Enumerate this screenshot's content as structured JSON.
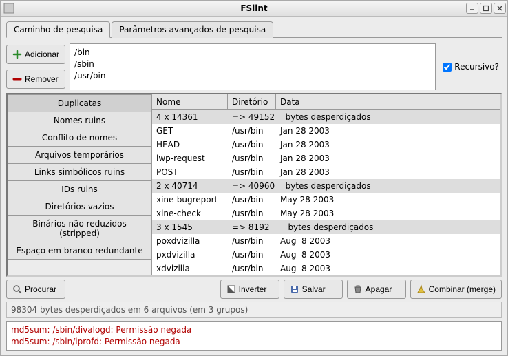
{
  "window": {
    "title": "FSlint"
  },
  "tabs": [
    {
      "label": "Caminho de pesquisa"
    },
    {
      "label": "Parâmetros avançados de pesquisa"
    }
  ],
  "path_buttons": {
    "add": "Adicionar",
    "remove": "Remover"
  },
  "paths": [
    "/bin",
    "/sbin",
    "/usr/bin"
  ],
  "recursive_label": "Recursivo?",
  "types": [
    "Duplicatas",
    "Nomes ruins",
    "Conflito de nomes",
    "Arquivos temporários",
    "Links simbólicos ruins",
    "IDs ruins",
    "Diretórios vazios",
    "Binários não reduzidos (stripped)",
    "Espaço em branco redundante"
  ],
  "headers": {
    "c1": "Nome",
    "c2": "Diretório",
    "c3": "Data"
  },
  "rows": [
    {
      "group": true,
      "c1": "4 x 14361",
      "c2": "=> 49152",
      "c3": "  bytes desperdiçados"
    },
    {
      "group": false,
      "c1": "GET",
      "c2": "/usr/bin",
      "c3": "Jan 28 2003"
    },
    {
      "group": false,
      "c1": "HEAD",
      "c2": "/usr/bin",
      "c3": "Jan 28 2003"
    },
    {
      "group": false,
      "c1": "lwp-request",
      "c2": "/usr/bin",
      "c3": "Jan 28 2003"
    },
    {
      "group": false,
      "c1": "POST",
      "c2": "/usr/bin",
      "c3": "Jan 28 2003"
    },
    {
      "group": true,
      "c1": "2 x 40714",
      "c2": "=> 40960",
      "c3": "  bytes desperdiçados"
    },
    {
      "group": false,
      "c1": "xine-bugreport",
      "c2": "/usr/bin",
      "c3": "May 28 2003"
    },
    {
      "group": false,
      "c1": "xine-check",
      "c2": "/usr/bin",
      "c3": "May 28 2003"
    },
    {
      "group": true,
      "c1": "3 x 1545",
      "c2": "=> 8192",
      "c3": "   bytes desperdiçados"
    },
    {
      "group": false,
      "c1": "poxdvizilla",
      "c2": "/usr/bin",
      "c3": "Aug  8 2003"
    },
    {
      "group": false,
      "c1": "pxdvizilla",
      "c2": "/usr/bin",
      "c3": "Aug  8 2003"
    },
    {
      "group": false,
      "c1": "xdvizilla",
      "c2": "/usr/bin",
      "c3": "Aug  8 2003"
    }
  ],
  "actions": {
    "search": "Procurar",
    "invert": "Inverter",
    "save": "Salvar",
    "delete": "Apagar",
    "merge": "Combinar (merge)"
  },
  "status": "98304 bytes desperdiçados em 6 arquivos (em 3 grupos)",
  "errors": [
    "md5sum: /sbin/divalogd: Permissão negada",
    "md5sum: /sbin/iprofd: Permissão negada"
  ]
}
